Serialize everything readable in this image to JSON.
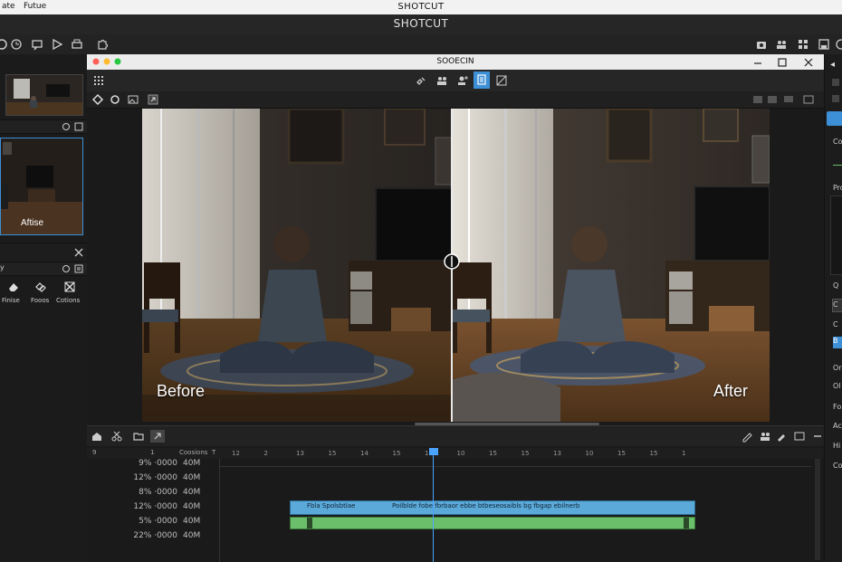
{
  "os_menu": {
    "item1": "ate",
    "item2": "Futue",
    "title": "SHOTCUT"
  },
  "app": {
    "title": "SHOTCUT"
  },
  "inner_window": {
    "title": "SOOECIN"
  },
  "viewer": {
    "before_label": "Before",
    "after_label": "After"
  },
  "left_panel": {
    "filter_tools": [
      {
        "label": "Finise",
        "icon": "eraser-icon"
      },
      {
        "label": "Fooos",
        "icon": "chain-icon"
      },
      {
        "label": "Cotions",
        "icon": "crop-icon"
      }
    ],
    "thumb_caption": "Aftise"
  },
  "right_panel": {
    "items": [
      "Co",
      "Pro",
      "Q",
      "C",
      "C",
      "B",
      "Or",
      "Ol",
      "Fo",
      "Ac",
      "Hi",
      "Co"
    ]
  },
  "timeline": {
    "header": {
      "col1": "9",
      "col2": "1",
      "col3": "Coosions",
      "col4": "T"
    },
    "ruler_ticks": [
      "12",
      "2",
      "13",
      "15",
      "14",
      "15",
      "15",
      "10",
      "15",
      "15",
      "13",
      "10",
      "15",
      "15",
      "1"
    ],
    "tracks": [
      {
        "value": "9%  ·0000",
        "size": "40M"
      },
      {
        "value": "12%  ·0000",
        "size": "40M"
      },
      {
        "value": "8%  ·0000",
        "size": "40M"
      },
      {
        "value": "12%  ·0000",
        "size": "40M"
      },
      {
        "value": "5%  ·0000",
        "size": "40M"
      },
      {
        "value": "22%  ·0000",
        "size": "40M"
      }
    ],
    "clip_blue_text": "Poilblde fobe fbrbaor ebbe btbeseosaibls bg fbgap ebilnerb",
    "clip_blue_prefix": "Fbla     Spolsbtlae",
    "clip_green_text": ""
  },
  "colors": {
    "accent": "#3d8fd6",
    "clip_blue": "#5aa9d8",
    "clip_green": "#6bbf6b",
    "playhead": "#4aa3ff"
  }
}
